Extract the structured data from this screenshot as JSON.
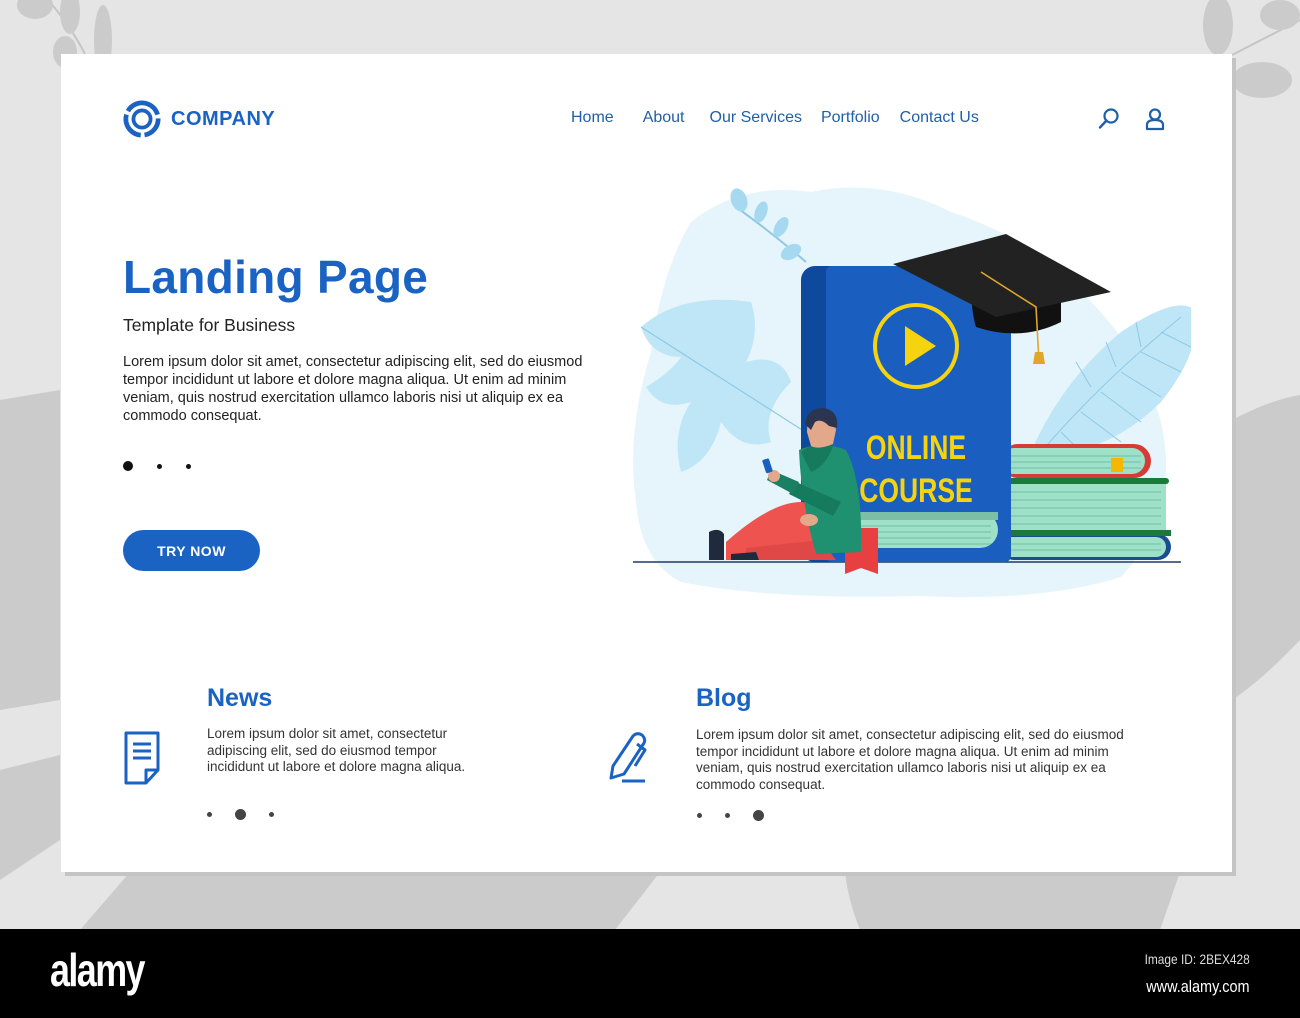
{
  "brand": {
    "name": "COMPANY",
    "primary_color": "#1a63c2",
    "nav_color": "#1f5faa"
  },
  "nav": {
    "items": [
      {
        "label": "Home"
      },
      {
        "label": "About"
      },
      {
        "label": "Our Services"
      },
      {
        "label": "Portfolio"
      },
      {
        "label": "Contact Us"
      }
    ],
    "icons": [
      "search-icon",
      "user-icon"
    ]
  },
  "hero": {
    "title": "Landing Page",
    "subtitle": "Template for Business",
    "body": "Lorem ipsum dolor sit amet, consectetur adipiscing elit, sed do eiusmod tempor incididunt ut labore et dolore magna aliqua. Ut enim ad minim veniam, quis nostrud exercitation ullamco laboris nisi ut aliquip ex ea commodo consequat.",
    "slider": {
      "count": 3,
      "active": 1
    },
    "cta_label": "TRY NOW"
  },
  "illustration": {
    "book_line1": "ONLINE",
    "book_line2": "COURSE",
    "icons": [
      "play-icon",
      "graduation-cap-icon",
      "person-with-phone",
      "book-stack"
    ],
    "colors": {
      "book_blue": "#1a5fc0",
      "book_spine": "#0d4a9e",
      "accent_yellow": "#f5d40f",
      "pages": "#9ee0c8",
      "red": "#e84040",
      "green": "#1a7a3a",
      "leaf": "#bfe6f7"
    }
  },
  "sections": {
    "news": {
      "title": "News",
      "body": "Lorem ipsum dolor sit amet, consectetur adipiscing elit, sed do eiusmod tempor incididunt ut labore et dolore magna aliqua.",
      "icon": "document-icon",
      "slider": {
        "count": 3,
        "active": 2
      }
    },
    "blog": {
      "title": "Blog",
      "body": "Lorem ipsum dolor sit amet, consectetur adipiscing elit, sed do eiusmod tempor incididunt ut labore et dolore magna aliqua. Ut enim ad minim veniam, quis nostrud exercitation ullamco laboris nisi ut aliquip ex ea commodo consequat.",
      "icon": "pen-icon",
      "slider": {
        "count": 3,
        "active": 3
      }
    }
  },
  "stock_footer": {
    "logo": "alamy",
    "image_id": "Image ID: 2BEX428",
    "url": "www.alamy.com"
  }
}
